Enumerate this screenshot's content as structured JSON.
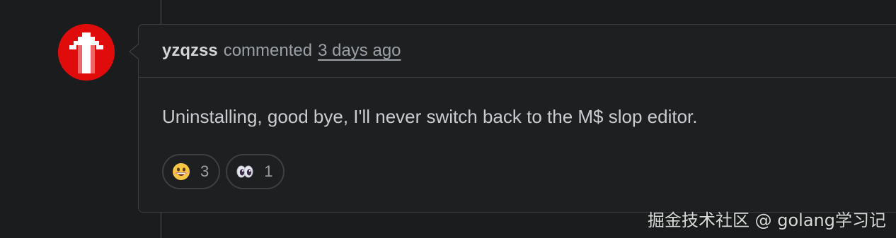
{
  "comment": {
    "author": "yzqzss",
    "action": "commented",
    "timestamp": "3 days ago",
    "body": "Uninstalling, good bye, I'll never switch back to the M$ slop editor.",
    "reactions": [
      {
        "icon": "grinning-face-icon",
        "count": "3"
      },
      {
        "icon": "eyes-icon",
        "count": "1"
      }
    ]
  },
  "watermark": "掘金技术社区 @ golang学习记",
  "colors": {
    "avatar_bg": "#e00c0c",
    "background": "#1b1c1d",
    "border": "#3a3d41"
  }
}
